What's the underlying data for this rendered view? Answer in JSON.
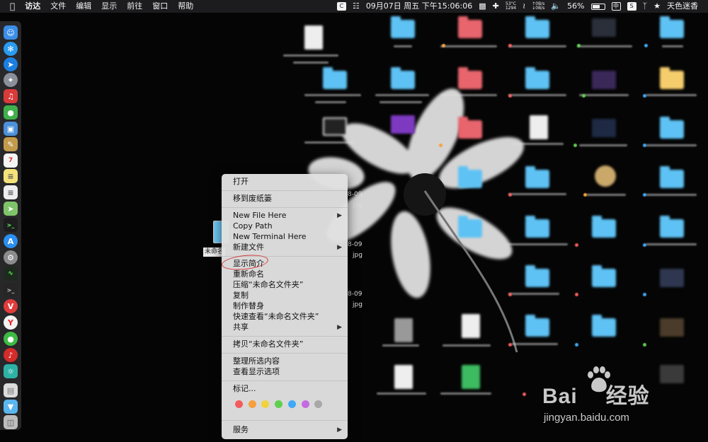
{
  "menubar": {
    "apple_icon": "apple-icon",
    "menus": [
      "访达",
      "文件",
      "编辑",
      "显示",
      "前往",
      "窗口",
      "帮助"
    ],
    "temp": "53°C",
    "rpm": "1294",
    "net_up": "0B/s",
    "net_down": "0B/s",
    "battery": "56%",
    "datetime": "09月07日 周五 下午15:06:06",
    "input_method": "中",
    "user": "天色迷香"
  },
  "context_menu": {
    "open": "打开",
    "move_to_trash": "移到废纸篓",
    "new_file_here": "New File Here",
    "copy_path": "Copy Path",
    "new_terminal_here": "New Terminal Here",
    "new_file": "新建文件",
    "get_info": "显示简介",
    "rename": "重新命名",
    "compress": "压缩“未命名文件夹”",
    "duplicate": "复制",
    "make_alias": "制作替身",
    "quick_look": "快速查看“未命名文件夹”",
    "share": "共享",
    "copy_item": "拷贝“未命名文件夹”",
    "clean_up_selection": "整理所选内容",
    "show_view_options": "查看显示选项",
    "tags": "标记...",
    "services": "服务",
    "tag_colors": [
      "#f25c5c",
      "#f5a03c",
      "#f2d23c",
      "#5fcf4e",
      "#3fa9f5",
      "#c36ce0",
      "#a8a8a8"
    ]
  },
  "desktop": {
    "selected_folder_label": "未命名",
    "date_fragments": [
      "8-09",
      "jpg",
      "jpg",
      "8-09",
      "jpg",
      "8-09",
      "jpg"
    ]
  },
  "watermark": {
    "brand": "Bai",
    "brand_cn": "经验",
    "url": "jingyan.baidu.com"
  }
}
